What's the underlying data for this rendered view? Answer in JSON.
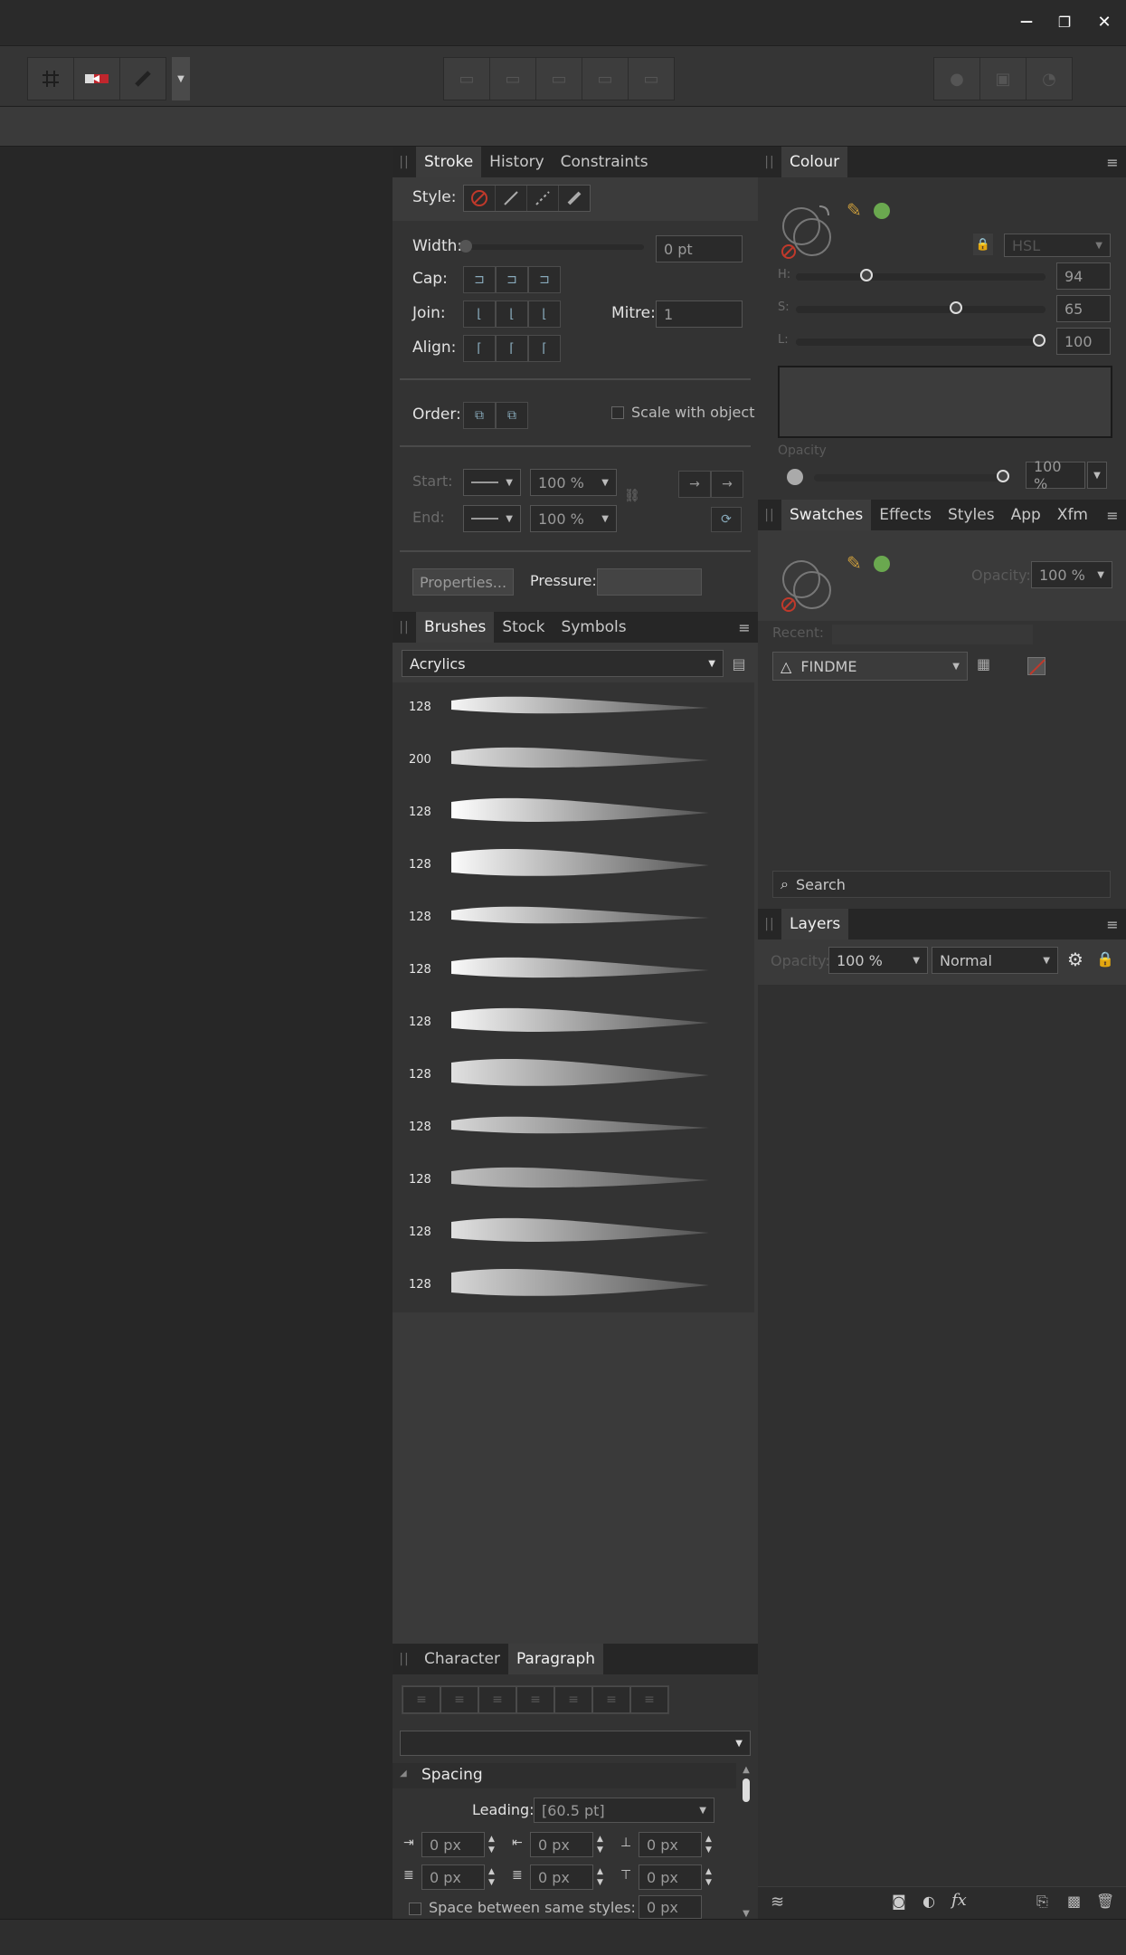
{
  "window": {
    "minimize_glyph": "—",
    "restore_glyph": "❐",
    "close_glyph": "✕"
  },
  "stroke_panel": {
    "tabs": [
      "Stroke",
      "History",
      "Constraints"
    ],
    "style_label": "Style:",
    "width_label": "Width:",
    "width_value": "0 pt",
    "cap_label": "Cap:",
    "join_label": "Join:",
    "mitre_label": "Mitre:",
    "mitre_value": "1",
    "align_label": "Align:",
    "order_label": "Order:",
    "scale_label": "Scale with object",
    "start_label": "Start:",
    "end_label": "End:",
    "start_scale": "100 %",
    "end_scale": "100 %",
    "properties_label": "Properties...",
    "pressure_label": "Pressure:"
  },
  "brushes_panel": {
    "tabs": [
      "Brushes",
      "Stock",
      "Symbols"
    ],
    "category": "Acrylics",
    "sizes": [
      "128",
      "200",
      "128",
      "128",
      "128",
      "128",
      "128",
      "128",
      "128",
      "128",
      "128",
      "128"
    ]
  },
  "paragraph_panel": {
    "tabs": [
      "Character",
      "Paragraph"
    ],
    "spacing_label": "Spacing",
    "leading_label": "Leading:",
    "leading_value": "[60.5 pt]",
    "px_values": [
      "0 px",
      "0 px",
      "0 px",
      "0 px",
      "0 px",
      "0 px"
    ],
    "space_between_label": "Space between same styles:",
    "space_between_value": "0 px"
  },
  "colour_panel": {
    "tab": "Colour",
    "model": "HSL",
    "h_label": "H:",
    "h_value": "94",
    "h_level": 0.27,
    "s_label": "S:",
    "s_value": "65",
    "s_level": 0.65,
    "l_label": "L:",
    "l_value": "100",
    "l_level": 1.0,
    "opacity_label": "Opacity",
    "opacity_value": "100 %",
    "fill_color": "#6aa84f"
  },
  "swatches_panel": {
    "tabs": [
      "Swatches",
      "Effects",
      "Styles",
      "App",
      "Xfm"
    ],
    "opacity_label": "Opacity:",
    "opacity_value": "100 %",
    "recent_label": "Recent:",
    "palette": "FINDME",
    "search_placeholder": "Search"
  },
  "layers_panel": {
    "tab": "Layers",
    "opacity_label": "Opacity:",
    "opacity_value": "100 %",
    "blend_mode": "Normal",
    "fx_label": "fx"
  }
}
